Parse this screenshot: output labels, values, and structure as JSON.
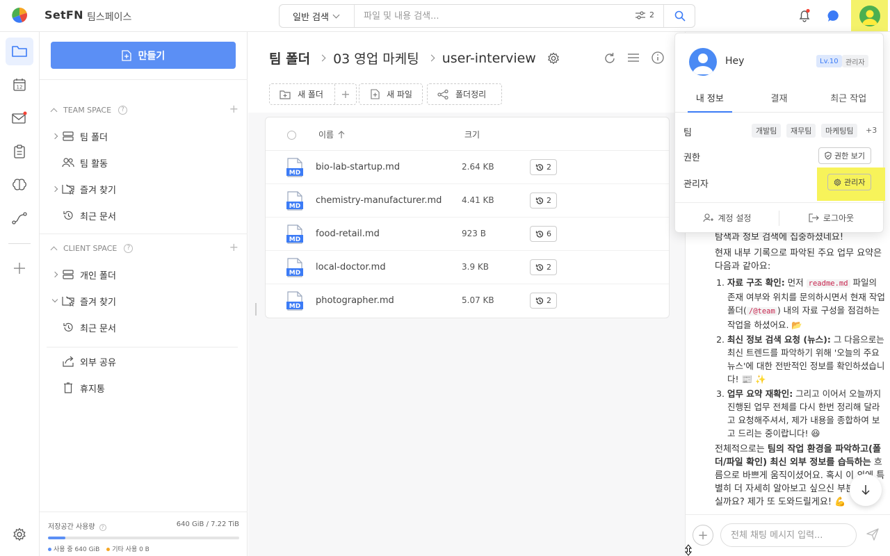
{
  "header": {
    "brand": "SetFN",
    "workspace": "팀스페이스",
    "search_mode": "일반 검색",
    "search_placeholder": "파일 및 내용 검색...",
    "filter_count": "2",
    "notification_dot_color": "#f44336"
  },
  "sidebar": {
    "create_label": "만들기",
    "team_space_title": "TEAM SPACE",
    "team_items": [
      {
        "label": "팀 폴더",
        "icon": "server-icon"
      },
      {
        "label": "팀 활동",
        "icon": "users-icon"
      },
      {
        "label": "즐겨 찾기",
        "icon": "star-folder-icon"
      },
      {
        "label": "최근 문서",
        "icon": "history-icon"
      }
    ],
    "client_space_title": "CLIENT SPACE",
    "client_items": [
      {
        "label": "개인 폴더",
        "icon": "server-icon"
      },
      {
        "label": "즐겨 찾기",
        "icon": "star-folder-icon"
      },
      {
        "label": "최근 문서",
        "icon": "history-icon"
      }
    ],
    "extra_items": [
      {
        "label": "외부 공유",
        "icon": "share-icon"
      },
      {
        "label": "휴지통",
        "icon": "trash-icon"
      }
    ],
    "storage": {
      "title": "저장공간 사용량",
      "value": "640 GiB / 7.22 TiB",
      "used_fraction": 0.09,
      "used_label": "사용 중 640 GiB",
      "other_label": "기타 사용 0 B"
    }
  },
  "main": {
    "breadcrumb": [
      "팀 폴더",
      "03 영업 마케팅",
      "user-interview"
    ],
    "toolbar": {
      "new_folder": "새 폴더",
      "new_file": "새 파일",
      "organize": "폴더정리"
    },
    "columns": {
      "name": "이름",
      "size": "크기"
    },
    "files": [
      {
        "name": "bio-lab-startup.md",
        "size": "2.64 KB",
        "versions": "2"
      },
      {
        "name": "chemistry-manufacturer.md",
        "size": "4.41 KB",
        "versions": "2"
      },
      {
        "name": "food-retail.md",
        "size": "923 B",
        "versions": "6"
      },
      {
        "name": "local-doctor.md",
        "size": "3.9 KB",
        "versions": "2"
      },
      {
        "name": "photographer.md",
        "size": "5.07 KB",
        "versions": "2"
      }
    ],
    "md_label": "MD"
  },
  "profile": {
    "name": "Hey",
    "level": "Lv.10",
    "role_badge": "관리자",
    "tabs": [
      "내 정보",
      "결재",
      "최근 작업"
    ],
    "team_label": "팀",
    "teams": [
      "개발팀",
      "재무팀",
      "마케팅팀"
    ],
    "teams_more": "+3",
    "permission_label": "권한",
    "permission_button": "권한 보기",
    "admin_label": "관리자",
    "admin_button": "관리자",
    "account_settings": "계정 설정",
    "logout": "로그아웃"
  },
  "chat": {
    "intro_fragment": "탐색과 정보 검색에 집중하셨네요!",
    "summary_intro": "현재 내부 기록으로 파악된 주요 업무 요약은 다음과 같아요:",
    "item1_title": "자료 구조 확인:",
    "item1_a": " 먼저 ",
    "item1_code1": "readme.md",
    "item1_b": " 파일의 존재 여부와 위치를 문의하시면서 현재 작업 폴더(",
    "item1_code2": "/@team",
    "item1_c": ") 내의 자료 구성을 점검하는 작업을 하셨어요. 📂",
    "item2_title": "최신 정보 검색 요청 (뉴스):",
    "item2_text": " 그 다음으로는 최신 트렌드를 파악하기 위해 '오늘의 주요 뉴스'에 대한 전반적인 정보를 확인하셨습니다! 📰 ✨",
    "item3_title": "업무 요약 재확인:",
    "item3_text": " 그리고 이어서 오늘까지 진행된 업무 전체를 다시 한번 정리해 달라고 요청해주셔서, 제가 내용을 종합하여 보고 드리는 중이랍니다! 😆",
    "closing_a": "전체적으로는 ",
    "closing_bold1": "팀의 작업 환경을 파악하고(폴더/파일 확인) 최신 외부 정보를 습득하는",
    "closing_b": " 흐름으로 바쁘게 움직이셨어요. 혹시 이 외에 특별히 더 자세히 알아보고 싶으신 부분이 있으실까요? 제가 또 도와드릴게요! 💪",
    "input_placeholder": "전체 채팅 메시지 입력..."
  },
  "colors": {
    "accent": "#5b8ff5",
    "highlight": "#f4f26a",
    "avatar_green": "#4caf50",
    "avatar_blue": "#4a8af4"
  }
}
